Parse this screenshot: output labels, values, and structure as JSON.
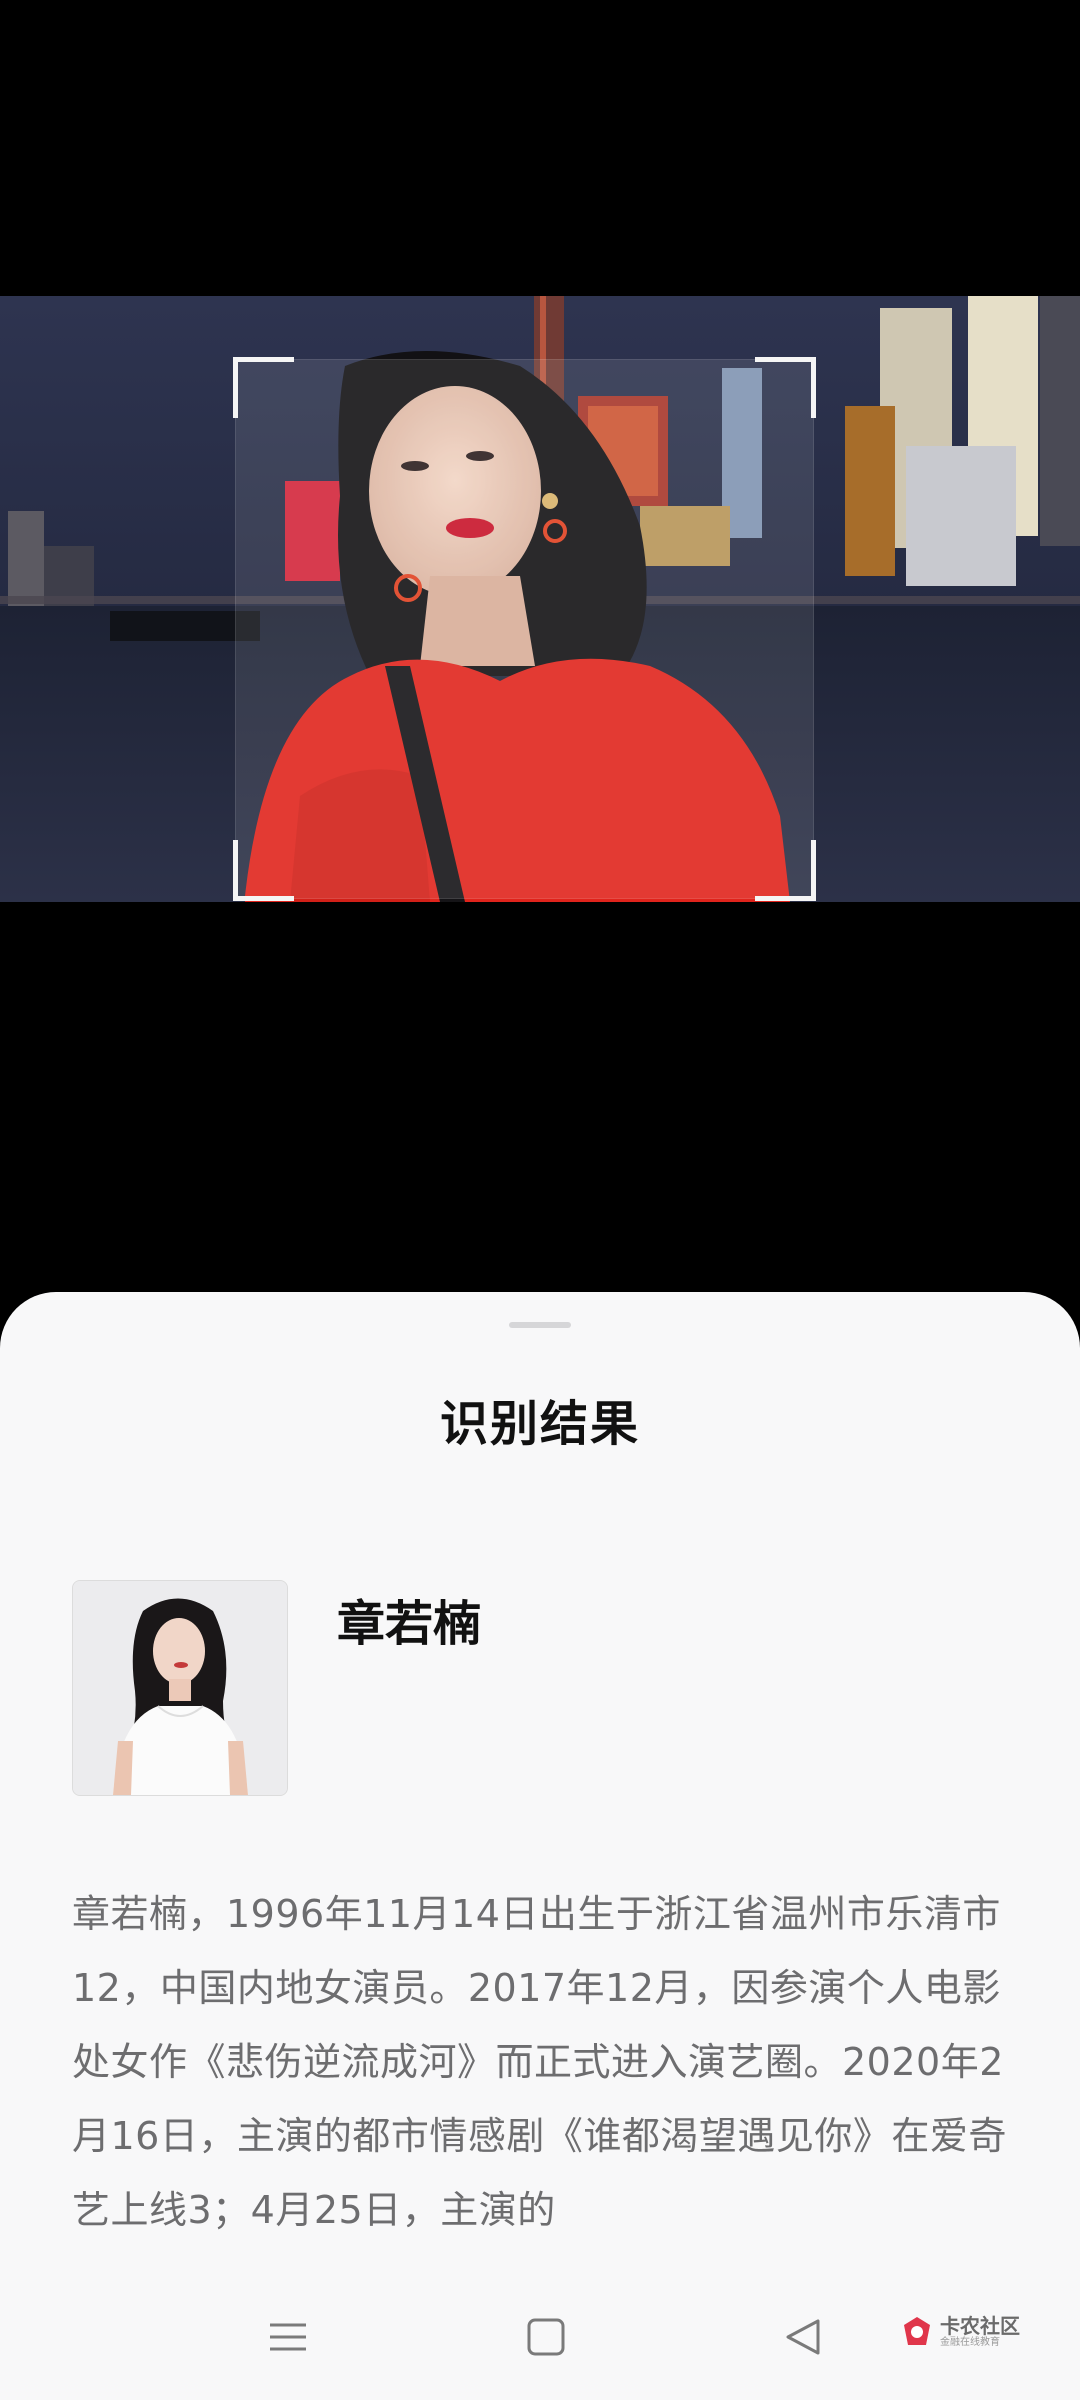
{
  "sheet": {
    "title": "识别结果"
  },
  "result": {
    "name": "章若楠",
    "description": "章若楠，1996年11月14日出生于浙江省温州市乐清市12，中国内地女演员。2017年12月，因参演个人电影处女作《悲伤逆流成河》而正式进入演艺圈。2020年2月16日，主演的都市情感剧《谁都渴望遇见你》在爱奇艺上线3；4月25日，主演的"
  },
  "navbar": {
    "menu_icon": "menu-icon",
    "home_icon": "home-icon",
    "back_icon": "back-icon"
  },
  "watermark": {
    "main": "卡农社区",
    "sub": "金融在线教育"
  },
  "colors": {
    "sheet_bg": "#f8f8f9",
    "photo_shirt": "#e0241c",
    "text_primary": "#111111",
    "text_secondary": "#6d6d6f"
  }
}
